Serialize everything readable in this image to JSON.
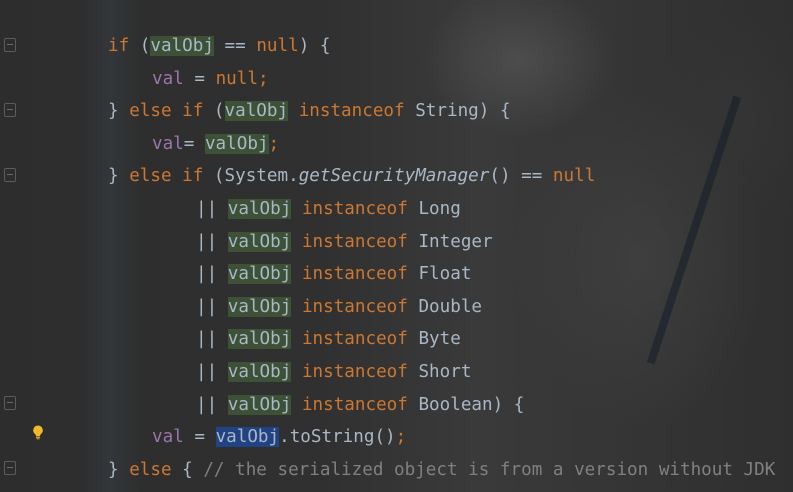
{
  "editor": {
    "lines": [
      {
        "indent": 0,
        "tokens": [
          {
            "t": "if",
            "c": "kw"
          },
          {
            "t": " (",
            "c": "loc"
          },
          {
            "t": "valObj",
            "c": "loc",
            "h": "green"
          },
          {
            "t": " == ",
            "c": "loc"
          },
          {
            "t": "null",
            "c": "kw"
          },
          {
            "t": ") {",
            "c": "loc"
          }
        ]
      },
      {
        "indent": 1,
        "tokens": [
          {
            "t": "val",
            "c": "var"
          },
          {
            "t": " = ",
            "c": "loc"
          },
          {
            "t": "null",
            "c": "kw"
          },
          {
            "t": ";",
            "c": "kw"
          }
        ]
      },
      {
        "indent": 0,
        "tokens": [
          {
            "t": "} ",
            "c": "loc"
          },
          {
            "t": "else if",
            "c": "kw"
          },
          {
            "t": " (",
            "c": "loc"
          },
          {
            "t": "valObj",
            "c": "loc",
            "h": "green"
          },
          {
            "t": " ",
            "c": "loc"
          },
          {
            "t": "instanceof",
            "c": "kw"
          },
          {
            "t": " String) {",
            "c": "loc"
          }
        ]
      },
      {
        "indent": 1,
        "tokens": [
          {
            "t": "val",
            "c": "var"
          },
          {
            "t": "= ",
            "c": "loc"
          },
          {
            "t": "valObj",
            "c": "loc",
            "h": "green"
          },
          {
            "t": ";",
            "c": "kw"
          }
        ]
      },
      {
        "indent": 0,
        "tokens": [
          {
            "t": "} ",
            "c": "loc"
          },
          {
            "t": "else if",
            "c": "kw"
          },
          {
            "t": " (System.",
            "c": "loc"
          },
          {
            "t": "getSecurityManager",
            "c": "ital"
          },
          {
            "t": "() == ",
            "c": "loc"
          },
          {
            "t": "null",
            "c": "kw"
          }
        ]
      },
      {
        "indent": 2,
        "tokens": [
          {
            "t": "|| ",
            "c": "loc"
          },
          {
            "t": "valObj",
            "c": "loc",
            "h": "green"
          },
          {
            "t": " ",
            "c": "loc"
          },
          {
            "t": "instanceof",
            "c": "kw"
          },
          {
            "t": " Long",
            "c": "loc"
          }
        ]
      },
      {
        "indent": 2,
        "tokens": [
          {
            "t": "|| ",
            "c": "loc"
          },
          {
            "t": "valObj",
            "c": "loc",
            "h": "green"
          },
          {
            "t": " ",
            "c": "loc"
          },
          {
            "t": "instanceof",
            "c": "kw"
          },
          {
            "t": " Integer",
            "c": "loc"
          }
        ]
      },
      {
        "indent": 2,
        "tokens": [
          {
            "t": "|| ",
            "c": "loc"
          },
          {
            "t": "valObj",
            "c": "loc",
            "h": "green"
          },
          {
            "t": " ",
            "c": "loc"
          },
          {
            "t": "instanceof",
            "c": "kw"
          },
          {
            "t": " Float",
            "c": "loc"
          }
        ]
      },
      {
        "indent": 2,
        "tokens": [
          {
            "t": "|| ",
            "c": "loc"
          },
          {
            "t": "valObj",
            "c": "loc",
            "h": "green"
          },
          {
            "t": " ",
            "c": "loc"
          },
          {
            "t": "instanceof",
            "c": "kw"
          },
          {
            "t": " Double",
            "c": "loc"
          }
        ]
      },
      {
        "indent": 2,
        "tokens": [
          {
            "t": "|| ",
            "c": "loc"
          },
          {
            "t": "valObj",
            "c": "loc",
            "h": "green"
          },
          {
            "t": " ",
            "c": "loc"
          },
          {
            "t": "instanceof",
            "c": "kw"
          },
          {
            "t": " Byte",
            "c": "loc"
          }
        ]
      },
      {
        "indent": 2,
        "tokens": [
          {
            "t": "|| ",
            "c": "loc"
          },
          {
            "t": "valObj",
            "c": "loc",
            "h": "green"
          },
          {
            "t": " ",
            "c": "loc"
          },
          {
            "t": "instanceof",
            "c": "kw"
          },
          {
            "t": " Short",
            "c": "loc"
          }
        ]
      },
      {
        "indent": 2,
        "tokens": [
          {
            "t": "|| ",
            "c": "loc"
          },
          {
            "t": "valObj",
            "c": "loc",
            "h": "green"
          },
          {
            "t": " ",
            "c": "loc"
          },
          {
            "t": "instanceof",
            "c": "kw"
          },
          {
            "t": " Boolean) {",
            "c": "loc"
          }
        ]
      },
      {
        "indent": 1,
        "tokens": [
          {
            "t": "val",
            "c": "var"
          },
          {
            "t": " = ",
            "c": "loc"
          },
          {
            "t": "valObj",
            "c": "loc",
            "h": "sel"
          },
          {
            "t": ".toString()",
            "c": "loc"
          },
          {
            "t": ";",
            "c": "kw"
          }
        ]
      },
      {
        "indent": 0,
        "tokens": [
          {
            "t": "} ",
            "c": "loc"
          },
          {
            "t": "else",
            "c": "kw"
          },
          {
            "t": " { ",
            "c": "loc"
          },
          {
            "t": "// the serialized object is from a version without JDK",
            "c": "cmt"
          }
        ]
      }
    ]
  },
  "colors": {
    "keyword": "#cc7832",
    "field": "#9876aa",
    "text": "#a9b7c6",
    "comment": "#808080",
    "usage_highlight": "#486e3c",
    "selection": "#214283"
  },
  "gutter": {
    "intention_icon": "lightbulb-icon",
    "fold_icon": "fold-marker-icon"
  }
}
